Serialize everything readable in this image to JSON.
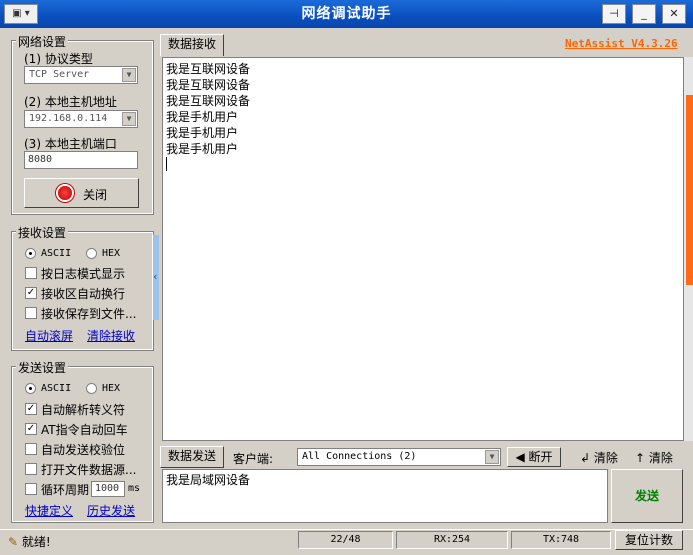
{
  "window": {
    "title": "网络调试助手",
    "brand": "NetAssist V4.3.26"
  },
  "network": {
    "legend": "网络设置",
    "protocol_label": "(1) 协议类型",
    "protocol_value": "TCP Server",
    "host_label": "(2) 本地主机地址",
    "host_value": "192.168.0.114",
    "port_label": "(3) 本地主机端口",
    "port_value": "8080",
    "close_label": "关闭"
  },
  "receive": {
    "legend": "接收设置",
    "ascii": "ASCII",
    "hex": "HEX",
    "opt_log": "按日志模式显示",
    "opt_wrap": "接收区自动换行",
    "opt_save": "接收保存到文件...",
    "link_auto": "自动滚屏",
    "link_clear": "清除接收"
  },
  "send": {
    "legend": "发送设置",
    "ascii": "ASCII",
    "hex": "HEX",
    "opt_escape": "自动解析转义符",
    "opt_at": "AT指令自动回车",
    "opt_checksum": "自动发送校验位",
    "opt_file": "打开文件数据源...",
    "opt_cycle": "循环周期",
    "cycle_value": "1000",
    "cycle_unit": "ms",
    "link_shortcut": "快捷定义",
    "link_history": "历史发送"
  },
  "recv_tab": "数据接收",
  "recv_lines": [
    "我是互联网设备",
    "我是互联网设备",
    "我是互联网设备",
    "我是手机用户",
    "我是手机用户",
    "我是手机用户"
  ],
  "send_bar": {
    "tab": "数据发送",
    "client_label": "客户端:",
    "client_value": "All Connections (2)",
    "disconnect": "断开",
    "clear1": "清除",
    "clear2": "清除"
  },
  "send_text": "我是局域网设备",
  "send_button": "发送",
  "status": {
    "ready": "就绪!",
    "counter": "22/48",
    "rx": "RX:254",
    "tx": "TX:748",
    "reset": "复位计数"
  },
  "colors": {
    "title_bar": "#0a4fbf",
    "brand": "#ff6600",
    "send_button_text": "#008000",
    "link": "#0000cc"
  }
}
